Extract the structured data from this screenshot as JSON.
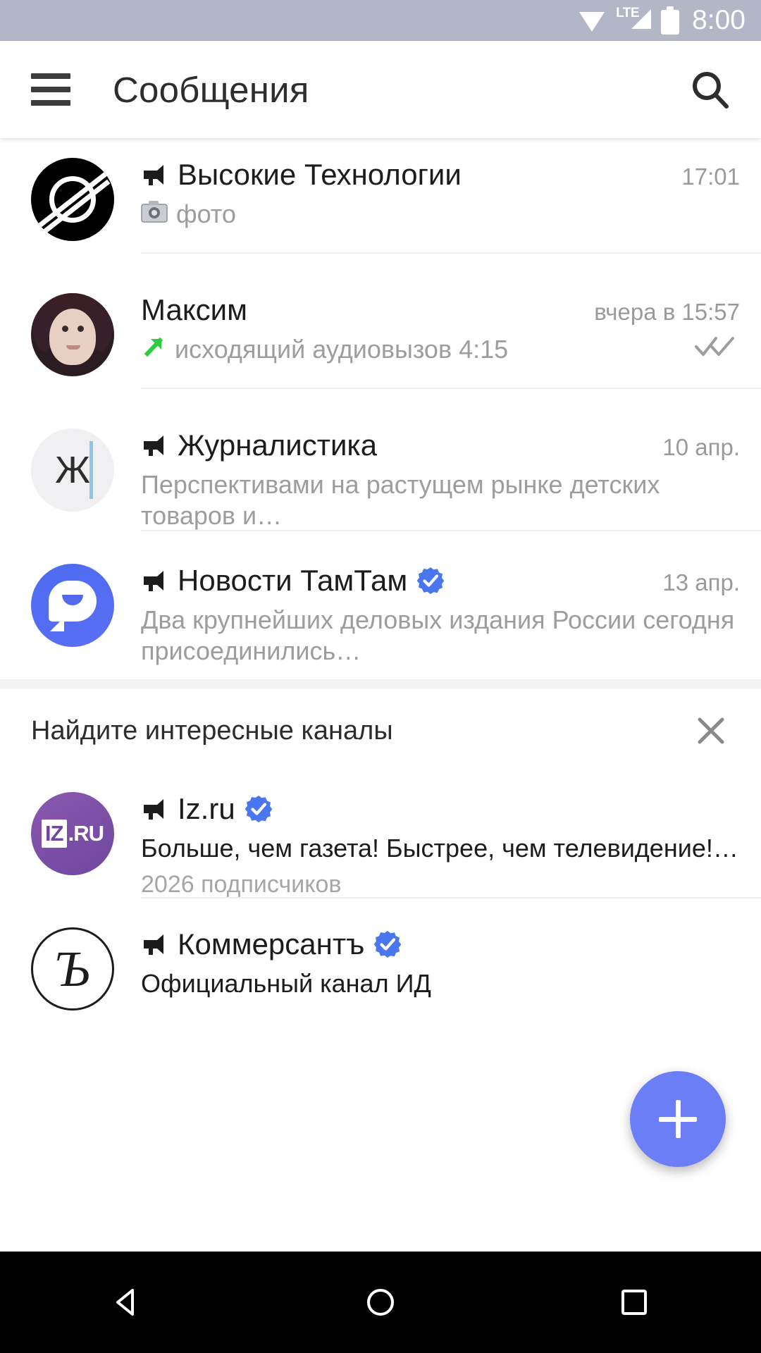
{
  "status_bar": {
    "time": "8:00",
    "network_label": "LTE",
    "icons": [
      "wifi-icon",
      "lte-signal-icon",
      "battery-icon"
    ],
    "background_color": "#b3b6c6"
  },
  "app_bar": {
    "title": "Сообщения",
    "menu_icon": "hamburger-menu-icon",
    "search_icon": "search-icon"
  },
  "chats": [
    {
      "title": "Высокие Технологии",
      "is_channel": true,
      "verified": false,
      "time": "17:01",
      "preview": "фото",
      "preview_icon": "camera-icon",
      "avatar_type": "hitech-logo",
      "has_checks": false
    },
    {
      "title": "Максим",
      "is_channel": false,
      "verified": false,
      "time": "вчера в 15:57",
      "preview": "исходящий аудиовызов 4:15",
      "preview_icon": "outgoing-call-arrow-icon",
      "avatar_type": "user-photo",
      "has_checks": true,
      "checks_icon": "double-check-icon"
    },
    {
      "title": "Журналистика",
      "is_channel": true,
      "verified": false,
      "time": "10 апр.",
      "preview": "Перспективами на растущем рынке детских товаров и…",
      "avatar_type": "letter",
      "avatar_letter": "Ж",
      "has_checks": false
    },
    {
      "title": "Новости ТамТам",
      "is_channel": true,
      "verified": true,
      "time": "13 апр.",
      "preview": "Два крупнейших деловых издания России сегодня присоединились…",
      "avatar_type": "tamtam-logo",
      "has_checks": false
    }
  ],
  "suggestions": {
    "header": "Найдите интересные каналы",
    "close_icon": "close-icon",
    "items": [
      {
        "title": "Iz.ru",
        "is_channel": true,
        "verified": true,
        "description": "Больше, чем газета! Быстрее, чем телевидение!…",
        "subscribers": "2026 подписчиков",
        "avatar_type": "izru-logo",
        "avatar_label_box": "IZ",
        "avatar_label_rest": ".RU"
      },
      {
        "title": "Коммерсантъ",
        "is_channel": true,
        "verified": true,
        "description": "Официальный канал ИД",
        "avatar_type": "kommersant-logo",
        "avatar_letter": "Ъ"
      }
    ]
  },
  "fab": {
    "label": "+",
    "icon": "plus-icon",
    "color": "#6b7ef5"
  },
  "nav_bar": {
    "back_icon": "back-triangle-icon",
    "home_icon": "home-circle-icon",
    "recents_icon": "recents-square-icon"
  },
  "colors": {
    "accent": "#6b7ef5",
    "verified_badge": "#4a76f0",
    "call_arrow": "#2ecc40",
    "status_bar": "#b3b6c6",
    "title_text": "#1c1c1c",
    "secondary_text": "#9d9d9d"
  }
}
